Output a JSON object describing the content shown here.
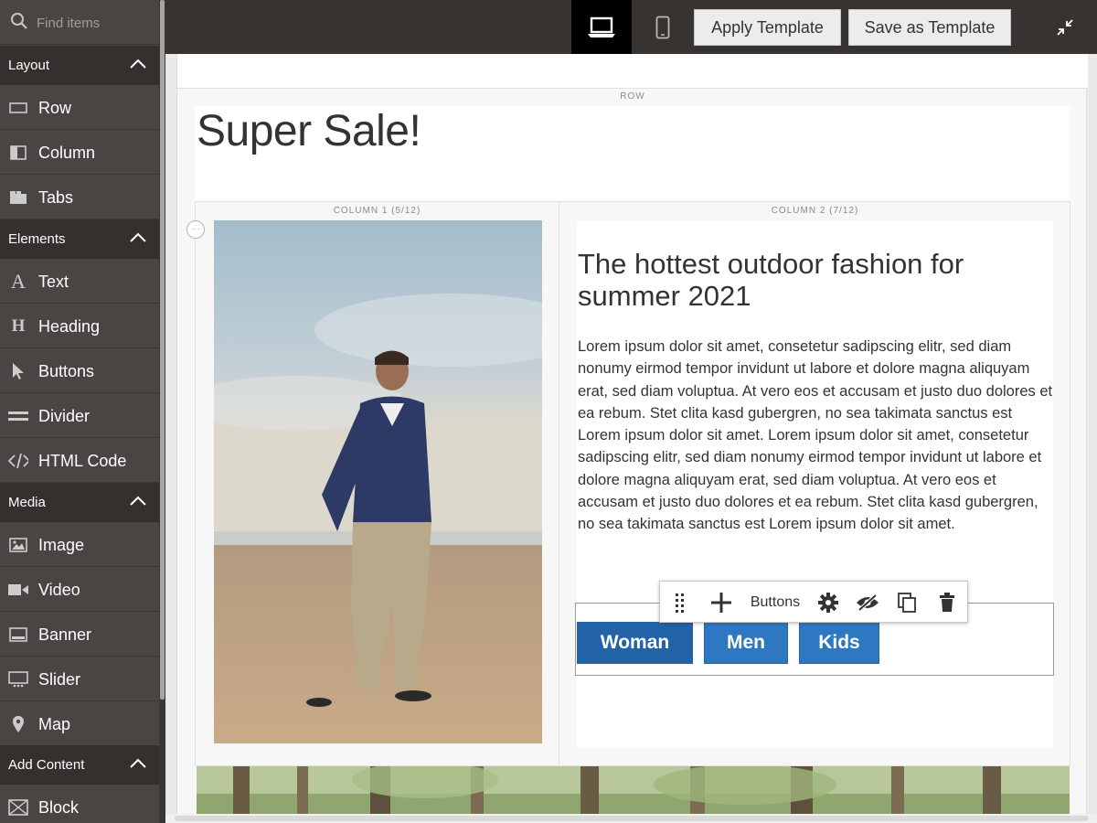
{
  "sidebar": {
    "search_placeholder": "Find items",
    "sections": [
      {
        "title": "Layout",
        "items": [
          {
            "label": "Row",
            "icon": "row-icon"
          },
          {
            "label": "Column",
            "icon": "column-icon"
          },
          {
            "label": "Tabs",
            "icon": "tabs-icon"
          }
        ]
      },
      {
        "title": "Elements",
        "items": [
          {
            "label": "Text",
            "icon": "text-icon"
          },
          {
            "label": "Heading",
            "icon": "heading-icon"
          },
          {
            "label": "Buttons",
            "icon": "buttons-icon"
          },
          {
            "label": "Divider",
            "icon": "divider-icon"
          },
          {
            "label": "HTML Code",
            "icon": "html-code-icon"
          }
        ]
      },
      {
        "title": "Media",
        "items": [
          {
            "label": "Image",
            "icon": "image-icon"
          },
          {
            "label": "Video",
            "icon": "video-icon"
          },
          {
            "label": "Banner",
            "icon": "banner-icon"
          },
          {
            "label": "Slider",
            "icon": "slider-icon"
          },
          {
            "label": "Map",
            "icon": "map-icon"
          }
        ]
      },
      {
        "title": "Add Content",
        "items": [
          {
            "label": "Block",
            "icon": "block-icon"
          }
        ]
      }
    ]
  },
  "toolbar": {
    "apply_template": "Apply Template",
    "save_as_template": "Save as Template"
  },
  "stage": {
    "row_label": "ROW",
    "title": "Super Sale!",
    "column1_label": "COLUMN 1 (5/12)",
    "column2_label": "COLUMN 2 (7/12)",
    "heading": "The hottest outdoor fashion for summer 2021",
    "body": "Lorem ipsum dolor sit amet, consetetur sadipscing elitr, sed diam nonumy eirmod tempor invidunt ut labore et dolore magna aliquyam erat, sed diam voluptua. At vero eos et accusam et justo duo dolores et ea rebum. Stet clita kasd gubergren, no sea takimata sanctus est Lorem ipsum dolor sit amet. Lorem ipsum dolor sit amet, consetetur sadipscing elitr, sed diam nonumy eirmod tempor invidunt ut labore et dolore magna aliquyam erat, sed diam voluptua. At vero eos et accusam et justo duo dolores et ea rebum. Stet clita kasd gubergren, no sea takimata sanctus est Lorem ipsum dolor sit amet.",
    "buttons": [
      "Woman",
      "Men",
      "Kids"
    ],
    "floating_toolbar_label": "Buttons"
  },
  "colors": {
    "sidebar_bg": "#4a4542",
    "section_bg": "#33302e",
    "topbar_bg": "#373330",
    "button_blue": "#2e78c2"
  }
}
